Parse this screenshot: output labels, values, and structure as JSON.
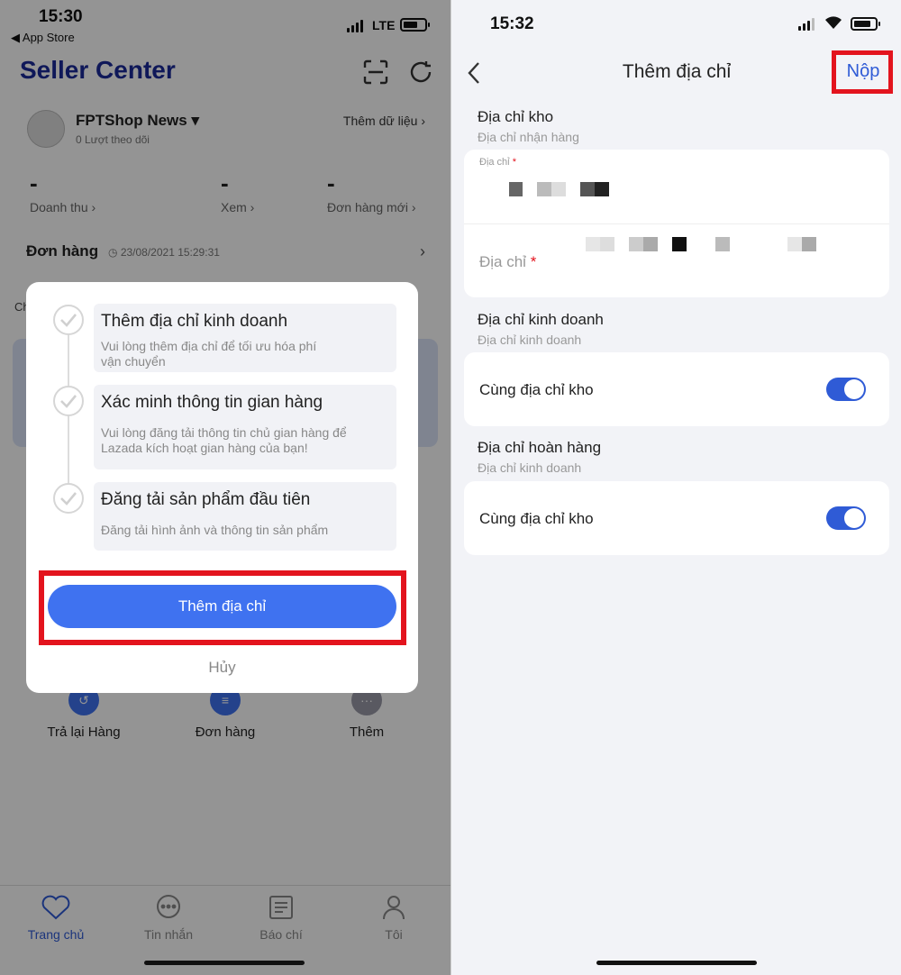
{
  "left": {
    "status": {
      "time": "15:30",
      "back_app": "◀ App Store",
      "network": "LTE"
    },
    "header": {
      "title": "Seller Center",
      "scan_icon": "scan-icon",
      "refresh_icon": "refresh-icon"
    },
    "shop": {
      "name": "FPTShop News ▾",
      "followers": "0 Lượt theo dõi",
      "add_data": "Thêm dữ liệu ›"
    },
    "stats": [
      {
        "value": "-",
        "label": "Doanh thu ›"
      },
      {
        "value": "-",
        "label": "Xem ›"
      },
      {
        "value": "-",
        "label": "Đơn hàng mới ›"
      }
    ],
    "orders": {
      "title": "Đơn hàng",
      "time": "23/08/2021 15:29:31",
      "chevron": "›",
      "partial": "Ch"
    },
    "quick": [
      {
        "label": "Trả lại Hàng",
        "icon": "return-icon"
      },
      {
        "label": "Đơn hàng",
        "icon": "order-icon"
      },
      {
        "label": "Thêm",
        "icon": "more-icon"
      }
    ],
    "tabs": [
      {
        "label": "Trang chủ",
        "icon": "home-icon"
      },
      {
        "label": "Tin nhắn",
        "icon": "chat-icon"
      },
      {
        "label": "Báo chí",
        "icon": "news-icon"
      },
      {
        "label": "Tôi",
        "icon": "profile-icon"
      }
    ],
    "modal": {
      "steps": [
        {
          "title": "Thêm địa chỉ kinh doanh",
          "desc1": "Vui lòng thêm địa chỉ để tối ưu hóa phí",
          "desc2": "vận chuyển"
        },
        {
          "title": "Xác minh thông tin gian hàng",
          "desc1": "Vui lòng đăng tải thông tin chủ gian hàng để",
          "desc2": "Lazada kích hoạt gian hàng của bạn!"
        },
        {
          "title": "Đăng tải sản phẩm đầu tiên",
          "desc1": "Đăng tải hình ảnh và thông tin sản phẩm",
          "desc2": ""
        }
      ],
      "add_button": "Thêm địa chỉ",
      "cancel": "Hủy"
    }
  },
  "right": {
    "status": {
      "time": "15:32"
    },
    "nav": {
      "title": "Thêm địa chỉ",
      "submit": "Nộp"
    },
    "warehouse": {
      "title": "Địa chỉ kho",
      "subtitle": "Địa chỉ nhận hàng",
      "field1_label": "Địa chỉ",
      "field2_label": "Địa chỉ",
      "required_mark": "*"
    },
    "business": {
      "title": "Địa chỉ kinh doanh",
      "subtitle": "Địa chỉ kinh doanh",
      "toggle_label": "Cùng địa chỉ kho",
      "toggle_on": true
    },
    "returns": {
      "title": "Địa chỉ hoàn hàng",
      "subtitle": "Địa chỉ kinh doanh",
      "toggle_label": "Cùng địa chỉ kho",
      "toggle_on": true
    }
  },
  "colors": {
    "brand_blue": "#2f5bd6",
    "button_blue": "#3f72f0",
    "highlight_red": "#e3141e",
    "title_navy": "#1a2a9a"
  }
}
